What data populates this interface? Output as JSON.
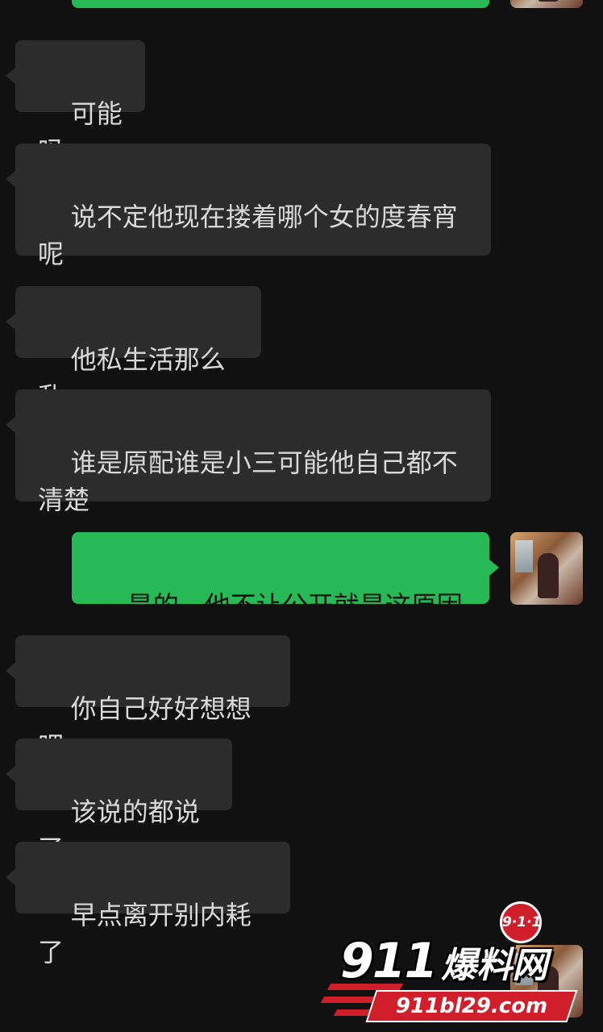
{
  "messages": [
    {
      "side": "out",
      "text": ""
    },
    {
      "side": "in",
      "text": "可能吗"
    },
    {
      "side": "in",
      "text": "说不定他现在搂着哪个女的度春宵呢"
    },
    {
      "side": "in",
      "text": "他私生活那么乱"
    },
    {
      "side": "in",
      "text": "谁是原配谁是小三可能他自己都不清楚"
    },
    {
      "side": "out",
      "text": "是的，他不让公开就是这原因"
    },
    {
      "side": "in",
      "text": "你自己好好想想吧"
    },
    {
      "side": "in",
      "text": "该说的都说了"
    },
    {
      "side": "in",
      "text": "早点离开别内耗了"
    }
  ],
  "watermark": {
    "badge": "9·1·1",
    "brand_number": "911",
    "brand_name": "爆料网",
    "url": "911bl29.com"
  },
  "colors": {
    "background": "#111111",
    "incoming_bubble": "#2c2c2c",
    "outgoing_bubble": "#28b957",
    "watermark_red": "#d01f2a"
  },
  "icons": {
    "self_avatar": "user-avatar-photo"
  }
}
